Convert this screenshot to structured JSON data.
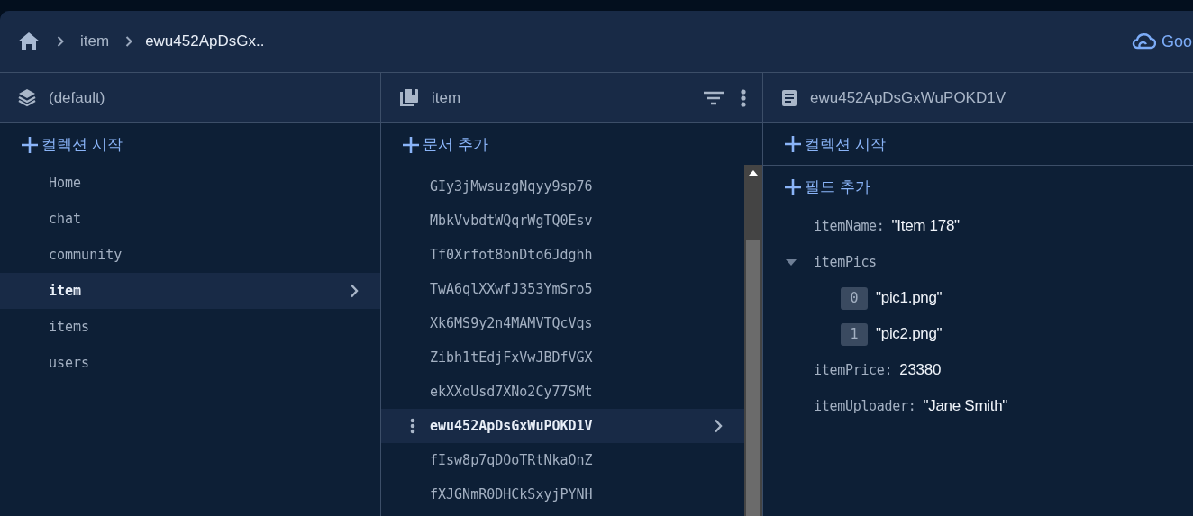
{
  "breadcrumb": {
    "items": [
      {
        "label": "item"
      },
      {
        "label": "ewu452ApDsGx.."
      }
    ],
    "cloud_link": "Goo"
  },
  "collections_panel": {
    "title": "(default)",
    "add_button": "컬렉션 시작",
    "items": [
      {
        "label": "Home",
        "selected": false
      },
      {
        "label": "chat",
        "selected": false
      },
      {
        "label": "community",
        "selected": false
      },
      {
        "label": "item",
        "selected": true
      },
      {
        "label": "items",
        "selected": false
      },
      {
        "label": "users",
        "selected": false
      }
    ]
  },
  "documents_panel": {
    "title": "item",
    "add_button": "문서 추가",
    "items": [
      {
        "label": "GIy3jMwsuzgNqyy9sp76",
        "selected": false
      },
      {
        "label": "MbkVvbdtWQqrWgTQ0Esv",
        "selected": false
      },
      {
        "label": "Tf0Xrfot8bnDto6Jdghh",
        "selected": false
      },
      {
        "label": "TwA6qlXXwfJ353YmSro5",
        "selected": false
      },
      {
        "label": "Xk6MS9y2n4MAMVTQcVqs",
        "selected": false
      },
      {
        "label": "Zibh1tEdjFxVwJBDfVGX",
        "selected": false
      },
      {
        "label": "ekXXoUsd7XNo2Cy77SMt",
        "selected": false
      },
      {
        "label": "ewu452ApDsGxWuPOKD1V",
        "selected": true
      },
      {
        "label": "fIsw8p7qDOoTRtNkaOnZ",
        "selected": false
      },
      {
        "label": "fXJGNmR0DHCkSxyjPYNH",
        "selected": false
      }
    ]
  },
  "document_panel": {
    "title": "ewu452ApDsGxWuPOKD1V",
    "add_collection_button": "컬렉션 시작",
    "add_field_button": "필드 추가",
    "fields": [
      {
        "kind": "value",
        "key": "itemName:",
        "value": "\"Item 178\""
      },
      {
        "kind": "array",
        "key": "itemPics",
        "expanded": true,
        "children": [
          {
            "index": "0",
            "value": "\"pic1.png\""
          },
          {
            "index": "1",
            "value": "\"pic2.png\""
          }
        ]
      },
      {
        "kind": "value",
        "key": "itemPrice:",
        "value": "23380"
      },
      {
        "kind": "value",
        "key": "itemUploader:",
        "value": "\"Jane Smith\""
      }
    ]
  }
}
